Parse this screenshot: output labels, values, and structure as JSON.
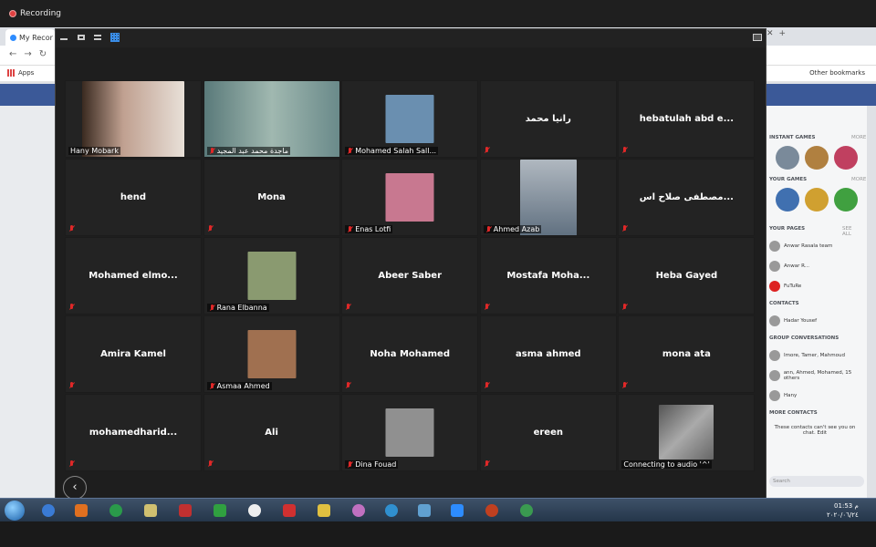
{
  "recording": {
    "label": "Recording"
  },
  "browser": {
    "tab_title": "My Recor",
    "apps_label": "Apps",
    "other_bookmarks": "Other bookmarks"
  },
  "facebook_sidebar": {
    "instant_games": "INSTANT GAMES",
    "instant_games_more": "MORE",
    "your_games": "YOUR GAMES",
    "your_games_more": "MORE",
    "your_pages": "YOUR PAGES",
    "your_pages_more": "SEE ALL",
    "pages": [
      "Anwar Rasala team",
      "Anwar R...",
      "FuTuRe"
    ],
    "contacts": "CONTACTS",
    "contact_name": "Hadar Yousef",
    "group_conversations": "GROUP CONVERSATIONS",
    "groups": [
      "Imore, Tamer, Mahmoud",
      "ann, Ahmed, Mohamed, 15 others",
      "Hany"
    ],
    "more_contacts": "MORE CONTACTS",
    "chat_note": "These contacts can't see you on chat. Edit",
    "search": "Search"
  },
  "zoom": {
    "participants": [
      {
        "name": "",
        "label": "Hany Mobark",
        "muted": false,
        "media": "video"
      },
      {
        "name": "",
        "label": "ماجدة محمد عبد المجيد",
        "muted": true,
        "media": "video"
      },
      {
        "name": "",
        "label": "Mohamed Salah Sall...",
        "muted": true,
        "media": "photo"
      },
      {
        "name": "رانيا محمد",
        "label": "",
        "muted": true,
        "media": "none"
      },
      {
        "name": "hebatulah abd e...",
        "label": "",
        "muted": true,
        "media": "none"
      },
      {
        "name": "hend",
        "label": "",
        "muted": true,
        "media": "none"
      },
      {
        "name": "Mona",
        "label": "",
        "muted": true,
        "media": "none"
      },
      {
        "name": "",
        "label": "Enas Lotfi",
        "muted": true,
        "media": "photo"
      },
      {
        "name": "",
        "label": "Ahmed Azab",
        "muted": true,
        "media": "video"
      },
      {
        "name": "مصطفى صلاح اس...",
        "label": "",
        "muted": true,
        "media": "none"
      },
      {
        "name": "Mohamed  elmo...",
        "label": "",
        "muted": true,
        "media": "none"
      },
      {
        "name": "",
        "label": "Rana Elbanna",
        "muted": true,
        "media": "photo"
      },
      {
        "name": "Abeer Saber",
        "label": "",
        "muted": true,
        "media": "none"
      },
      {
        "name": "Mostafa  Moha...",
        "label": "",
        "muted": true,
        "media": "none"
      },
      {
        "name": "Heba Gayed",
        "label": "",
        "muted": true,
        "media": "none"
      },
      {
        "name": "Amira Kamel",
        "label": "",
        "muted": true,
        "media": "none"
      },
      {
        "name": "",
        "label": "Asmaa Ahmed",
        "muted": true,
        "media": "photo"
      },
      {
        "name": "Noha Mohamed",
        "label": "",
        "muted": true,
        "media": "none"
      },
      {
        "name": "asma ahmed",
        "label": "",
        "muted": true,
        "media": "none"
      },
      {
        "name": "mona ata",
        "label": "",
        "muted": true,
        "media": "none"
      },
      {
        "name": "mohamedharid...",
        "label": "",
        "muted": true,
        "media": "none"
      },
      {
        "name": "Ali",
        "label": "",
        "muted": true,
        "media": "none"
      },
      {
        "name": "",
        "label": "Dina Fouad",
        "muted": true,
        "media": "photo"
      },
      {
        "name": "ereen",
        "label": "",
        "muted": true,
        "media": "none"
      },
      {
        "name": "",
        "label": "Connecting to audio '^'",
        "muted": false,
        "media": "photo"
      }
    ],
    "prev_page": "‹"
  },
  "taskbar": {
    "time": "01:53 م",
    "date": "٢٠٢٠/٠٦/٢٤"
  },
  "colors": {
    "zoom_bg": "#1e1e1e",
    "tile_bg": "#232323",
    "muted_red": "#e02828",
    "facebook_blue": "#3b5998",
    "zoom_blue": "#2d8cff"
  }
}
